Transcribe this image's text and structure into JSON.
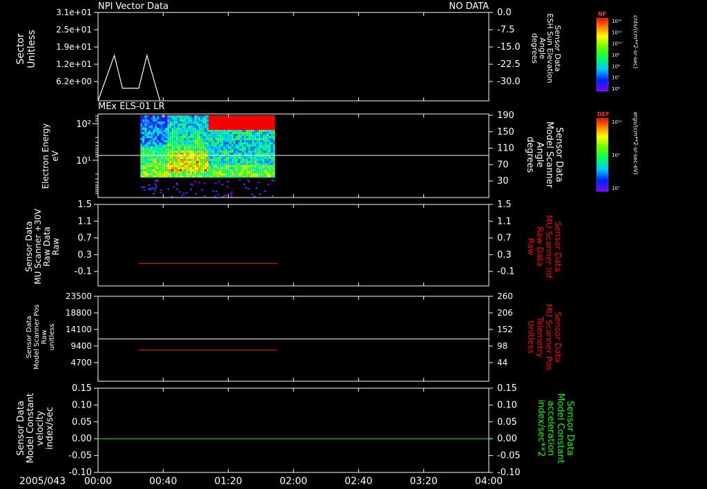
{
  "panel1": {
    "title": "NPI Vector Data",
    "status": "NO DATA",
    "left_label": [
      "Sector",
      "Unitless"
    ],
    "right_label": [
      "Sensor Data",
      "ESH Sun Elevation",
      "Angle",
      "degrees"
    ]
  },
  "panel2": {
    "title": "MEx ELS-01 LR",
    "left_label": [
      "Electron Energy",
      "eV"
    ],
    "right_label": [
      "Sensor Data",
      "Model Scanner",
      "Angle",
      "degrees"
    ]
  },
  "panel3": {
    "left_label": [
      "Sensor Data",
      "MU Scanner +30V",
      "Raw Data",
      "Raw"
    ],
    "right_label": [
      "Sensor Data",
      "MU Scanner Inf",
      "Raw Data",
      "Raw"
    ]
  },
  "panel4": {
    "left_label": [
      "Sensor Data",
      "Model Scanner Pos",
      "Raw",
      "unitless"
    ],
    "right_label": [
      "Sensor Data",
      "MU Scanner Pos",
      "Telemetry",
      "Unitless"
    ]
  },
  "panel5": {
    "left_label": [
      "Sensor Data",
      "Model Constant",
      "velocity",
      "index/sec"
    ],
    "right_label": [
      "Sensor Data",
      "Model Constant",
      "acceleration",
      "index/sec**2"
    ]
  },
  "colorbar_nf": {
    "label": "NF",
    "units": "cnts/(cm**2-sr-sec)",
    "ticks": [
      "10¹²",
      "10¹¹",
      "10¹⁰",
      "10⁹",
      "10⁸",
      "10⁷",
      "10⁶"
    ]
  },
  "colorbar_def": {
    "label": "DEF",
    "units": "ergs/(cm**2-sr-sec-eV)",
    "ticks": [
      "10¹¹",
      "10⁹",
      "10⁷"
    ]
  },
  "colors": {
    "background": "#000000",
    "axes": "#ffffff",
    "red_trace": "#ff0000",
    "green_trace": "#00ff00"
  },
  "chart_data": [
    {
      "type": "line",
      "title": "NPI Vector Data",
      "annotation": "NO DATA",
      "ylabel": "Sector Unitless",
      "y_ticks": [
        "3.1e+01",
        "2.5e+01",
        "1.9e+01",
        "1.2e+01",
        "6.2e+00"
      ],
      "ylim": [
        0,
        31
      ],
      "y2label": "Sensor Data ESH Sun Elevation Angle degrees",
      "y2_ticks": [
        "0.0",
        "-7.5",
        "-15.0",
        "-22.5",
        "-30.0"
      ],
      "y2lim": [
        -35,
        0
      ],
      "series": [
        {
          "x": [
            0,
            10,
            15,
            25,
            30,
            38
          ],
          "y": [
            -35,
            -17,
            -30,
            -30,
            -17,
            -35
          ],
          "color": "#ffffff"
        }
      ]
    },
    {
      "type": "heatmap",
      "title": "MEx ELS-01 LR",
      "ylabel": "Electron Energy eV",
      "y_ticks": [
        "10²",
        "10¹"
      ],
      "y_scale": "log",
      "y2label": "Sensor Data Model Scanner Angle degrees",
      "y2_ticks": [
        "190",
        "150",
        "110",
        "70",
        "30"
      ],
      "data_start": "00:26",
      "data_end": "01:48",
      "reference_line_y2": 92
    },
    {
      "type": "line",
      "ylabel": "Sensor Data MU Scanner +30V Raw Data Raw",
      "y_ticks": [
        "1.5",
        "1.1",
        "0.7",
        "0.3",
        "-0.1"
      ],
      "ylim": [
        -0.5,
        1.5
      ],
      "y2label": "Sensor Data MU Scanner Inf Raw Data Raw",
      "y2_ticks": [
        "1.5",
        "1.1",
        "0.7",
        "0.3",
        "-0.1"
      ],
      "series": [
        {
          "x_start": "00:25",
          "x_end": "01:50",
          "value": 0.05,
          "color": "#ff0000"
        }
      ]
    },
    {
      "type": "line",
      "ylabel": "Sensor Data Model Scanner Pos Raw unitless",
      "y_ticks": [
        "23500",
        "18800",
        "14100",
        "9400",
        "4700"
      ],
      "ylim": [
        0,
        23500
      ],
      "y2label": "Sensor Data MU Scanner Pos Telemetry Unitless",
      "y2_ticks": [
        "260",
        "206",
        "152",
        "98",
        "44"
      ],
      "series": [
        {
          "x_start": "00:00",
          "x_end": "04:00",
          "value": 11700,
          "color": "#ffffff"
        },
        {
          "x_start": "00:25",
          "x_end": "01:50",
          "value": 8700,
          "color": "#ff0000"
        }
      ]
    },
    {
      "type": "line",
      "ylabel": "Sensor Data Model Constant velocity index/sec",
      "y_ticks": [
        "0.15",
        "0.10",
        "0.05",
        "0.00",
        "-0.05",
        "-0.10"
      ],
      "ylim": [
        -0.1,
        0.15
      ],
      "y2label": "Sensor Data Model Constant acceleration index/sec**2",
      "y2_ticks": [
        "0.15",
        "0.10",
        "0.05",
        "0.00",
        "-0.05",
        "-0.10"
      ],
      "series": [
        {
          "x_start": "00:00",
          "x_end": "04:00",
          "value": 0.0,
          "color": "#00ff00"
        }
      ]
    }
  ],
  "x_axis": {
    "date_label": "2005/043",
    "ticks": [
      "00:00",
      "00:40",
      "01:20",
      "02:00",
      "02:40",
      "03:20",
      "04:00"
    ],
    "xlim": [
      "00:00",
      "04:00"
    ]
  }
}
